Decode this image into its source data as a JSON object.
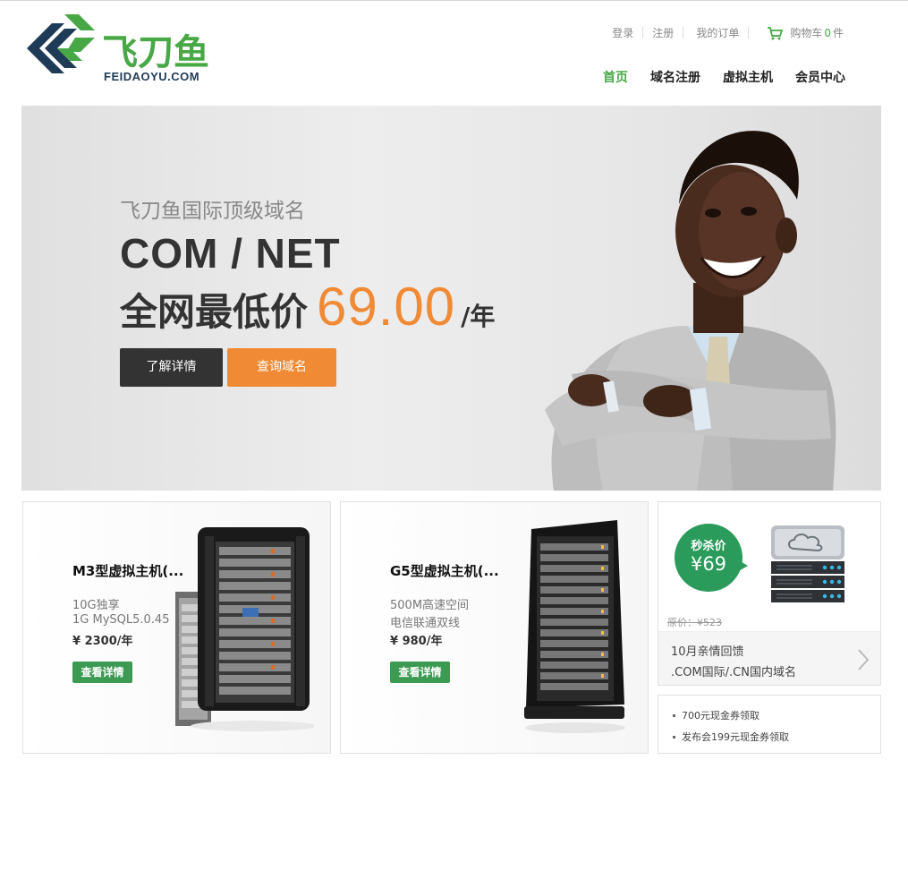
{
  "logo": {
    "cn": "飞刀鱼",
    "en": "FEIDAOYU.COM"
  },
  "toplinks": {
    "login": "登录",
    "register": "注册",
    "orders": "我的订单",
    "cart_prefix": "购物车",
    "cart_count": "0",
    "cart_suffix": "件"
  },
  "nav": [
    {
      "label": "首页"
    },
    {
      "label": "域名注册"
    },
    {
      "label": "虚拟主机"
    },
    {
      "label": "会员中心"
    }
  ],
  "banner": {
    "subtitle": "飞刀鱼国际顶级域名",
    "title": "COM / NET",
    "price_label": "全网最低价",
    "price": "69.00",
    "unit": "/年",
    "btn_details": "了解详情",
    "btn_query": "查询域名"
  },
  "products": [
    {
      "title": "M3型虚拟主机(...",
      "line1": "10G独享",
      "line2": "1G MySQL5.0.45",
      "price": "¥ 2300/年",
      "button": "查看详情"
    },
    {
      "title": "G5型虚拟主机(...",
      "line1": "500M高速空间",
      "line2": "电信联通双线",
      "price": "¥ 980/年",
      "button": "查看详情"
    }
  ],
  "promo": {
    "badge_label": "秒杀价",
    "badge_price": "¥69",
    "old_price": "原价：¥523",
    "line1": "10月亲情回馈",
    "line2": ".COM国际/.CN国内域名"
  },
  "notices": [
    "700元现金券领取",
    "发布会199元现金券领取"
  ],
  "colors": {
    "brand_green": "#47a845",
    "accent_orange": "#f08a35",
    "button_green": "#3c9a53",
    "badge_green": "#2a9b5b",
    "dark": "#333333"
  }
}
